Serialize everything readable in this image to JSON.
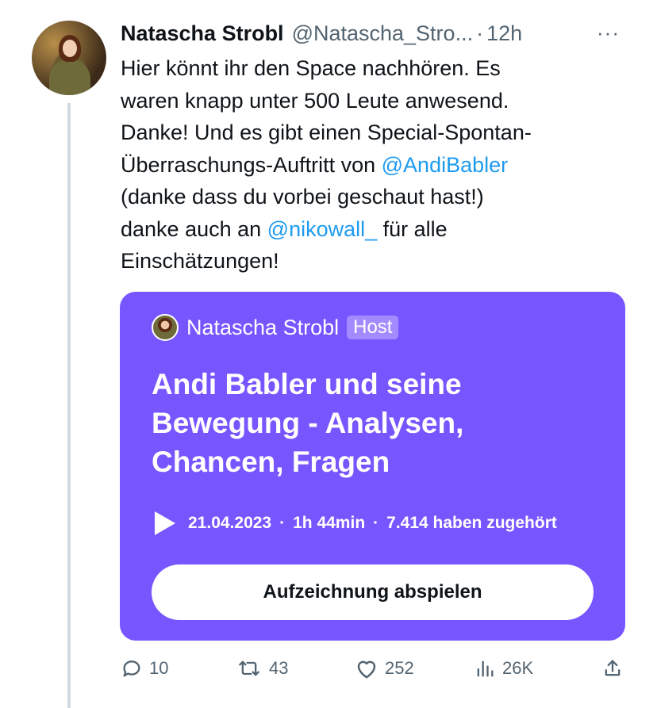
{
  "tweet": {
    "author_name": "Natascha Strobl",
    "author_handle": "@Natascha_Stro...",
    "separator": "·",
    "time": "12h",
    "more": "···",
    "text": {
      "line1": "Hier könnt ihr den Space nachhören. Es",
      "line2": "waren knapp unter 500 Leute anwesend.",
      "line3": "Danke! Und es gibt einen Special-Spontan-",
      "line4_prefix": "Überraschungs-Auftritt von ",
      "line4_mention": "@AndiBabler",
      "line5": "(danke dass du vorbei geschaut hast!)",
      "line6_prefix": "danke auch an ",
      "line6_mention": "@nikowall_",
      "line6_suffix": " für alle",
      "line7": "Einschätzungen!"
    }
  },
  "space_card": {
    "host_name": "Natascha Strobl",
    "host_badge": "Host",
    "title_line1": "Andi Babler und seine",
    "title_line2": "Bewegung - Analysen,",
    "title_line3": "Chancen, Fragen",
    "date": "21.04.2023",
    "sep": "·",
    "duration": "1h 44min",
    "listeners": "7.414 haben zugehört",
    "button_label": "Aufzeichnung abspielen",
    "accent_color": "#7856ff"
  },
  "actions": {
    "replies": "10",
    "retweets": "43",
    "likes": "252",
    "views": "26K"
  },
  "colors": {
    "mention": "#1d9bf0",
    "secondary_text": "#536471"
  }
}
